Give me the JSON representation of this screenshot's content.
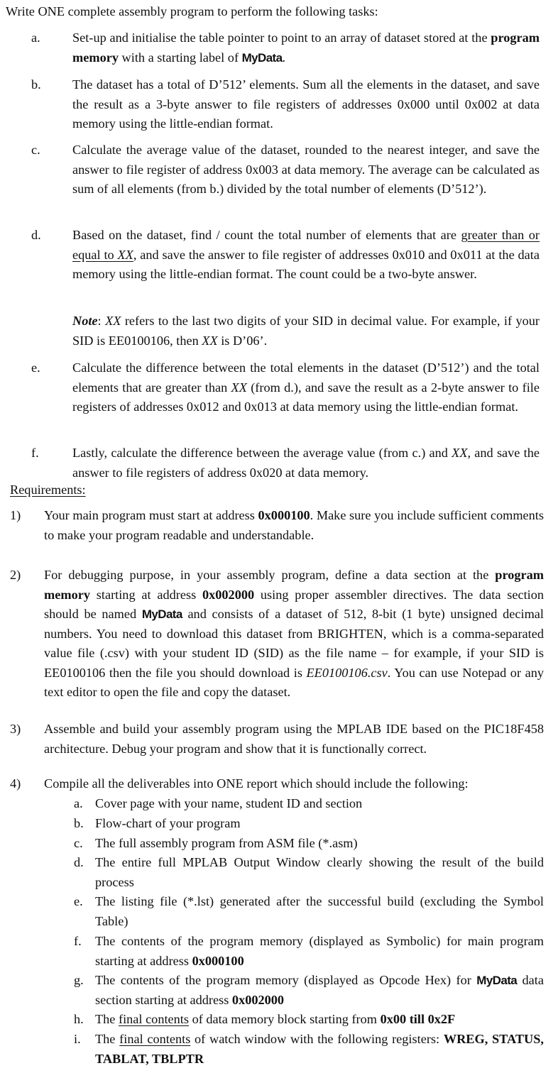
{
  "title": "Write ONE complete assembly program to perform the following tasks:",
  "tasks": [
    {
      "letter": "a.",
      "parts": [
        "Set-up and initialise the table pointer to point to an array of dataset stored at the ",
        "program memory",
        " with a starting label of ",
        "MyData",
        "."
      ]
    },
    {
      "letter": "b.",
      "text": "The dataset has a total of D’512’ elements. Sum all the elements in the dataset, and save the result as a 3-byte answer to file registers of addresses 0x000 until 0x002 at data memory using the little-endian format."
    },
    {
      "letter": "c.",
      "text": "Calculate the average value of the dataset, rounded to the nearest integer, and save the answer to file register of address 0x003 at data memory. The average can be calculated as sum of all elements (from b.) divided by the total number of elements (D’512’)."
    },
    {
      "letter": "d.",
      "parts": [
        "Based on the dataset, find / count the total number of elements that are ",
        "greater than or equal to ",
        "XX",
        ", and save the answer to file register of addresses 0x010 and 0x011 at the data memory using the little-endian format. The count could be a two-byte answer."
      ]
    },
    {
      "letter": "e.",
      "parts": [
        "Calculate the difference between the total elements in the dataset (D’512’) and the total elements that are greater than ",
        "XX",
        " (from d.), and save the result as a 2-byte answer to file registers of addresses 0x012 and 0x013 at data memory using the little-endian format."
      ]
    },
    {
      "letter": "f.",
      "parts": [
        "Lastly, calculate the difference between the average value (from c.) and ",
        "XX",
        ", and save the answer to file registers of address 0x020 at data memory."
      ]
    }
  ],
  "note": {
    "label": "Note",
    "parts": [
      ": ",
      "XX",
      " refers to the last two digits of your SID in decimal value. For example, if your SID is EE0100106, then ",
      "XX",
      " is D’06’."
    ]
  },
  "requirements_heading": "Requirements:",
  "requirements": [
    {
      "num": "1)",
      "parts": [
        "Your main program must start at address ",
        "0x000100",
        ". Make sure you include sufficient comments to make your program readable and understandable."
      ]
    },
    {
      "num": "2)",
      "parts": [
        "For debugging purpose, in your assembly program, define a data section at the ",
        "program memory",
        " starting at address ",
        "0x002000",
        " using proper assembler directives. The data section should be named ",
        "MyData",
        " and consists of a dataset of 512, 8-bit (1 byte) unsigned decimal numbers. You need to download this dataset from BRIGHTEN, which is a comma-separated value file (.csv) with your student ID (SID) as the file name – for example, if your SID is EE0100106 then the file you should download is ",
        "EE0100106.csv",
        ". You can use Notepad or any text editor to open the file and copy the dataset."
      ]
    },
    {
      "num": "3)",
      "text": "Assemble and build your assembly program using the MPLAB IDE based on the PIC18F458 architecture. Debug your program and show that it is functionally correct."
    },
    {
      "num": "4)",
      "text": "Compile all the deliverables into ONE report which should include the following:"
    }
  ],
  "deliverables": [
    {
      "letter": "a.",
      "text": "Cover page with your name, student ID and section"
    },
    {
      "letter": "b.",
      "text": "Flow-chart of your program"
    },
    {
      "letter": "c.",
      "text": "The full assembly program from ASM file (*.asm)"
    },
    {
      "letter": "d.",
      "text": "The entire full MPLAB Output Window clearly showing the result of the build process"
    },
    {
      "letter": "e.",
      "text": "The listing file (*.lst) generated after the successful build (excluding the Symbol Table)"
    },
    {
      "letter": "f.",
      "parts": [
        "The contents of the program memory (displayed as Symbolic) for main program starting at address ",
        "0x000100"
      ]
    },
    {
      "letter": "g.",
      "parts": [
        "The contents of the program memory (displayed as Opcode Hex) for ",
        "MyData",
        " data section starting at address ",
        "0x002000"
      ]
    },
    {
      "letter": "h.",
      "parts": [
        "The ",
        "final contents",
        " of data memory block starting from ",
        "0x00 till 0x2F"
      ]
    },
    {
      "letter": "i.",
      "parts": [
        "The ",
        "final contents",
        " of watch window with the following registers: ",
        "WREG, STATUS, TABLAT, TBLPTR"
      ]
    }
  ]
}
